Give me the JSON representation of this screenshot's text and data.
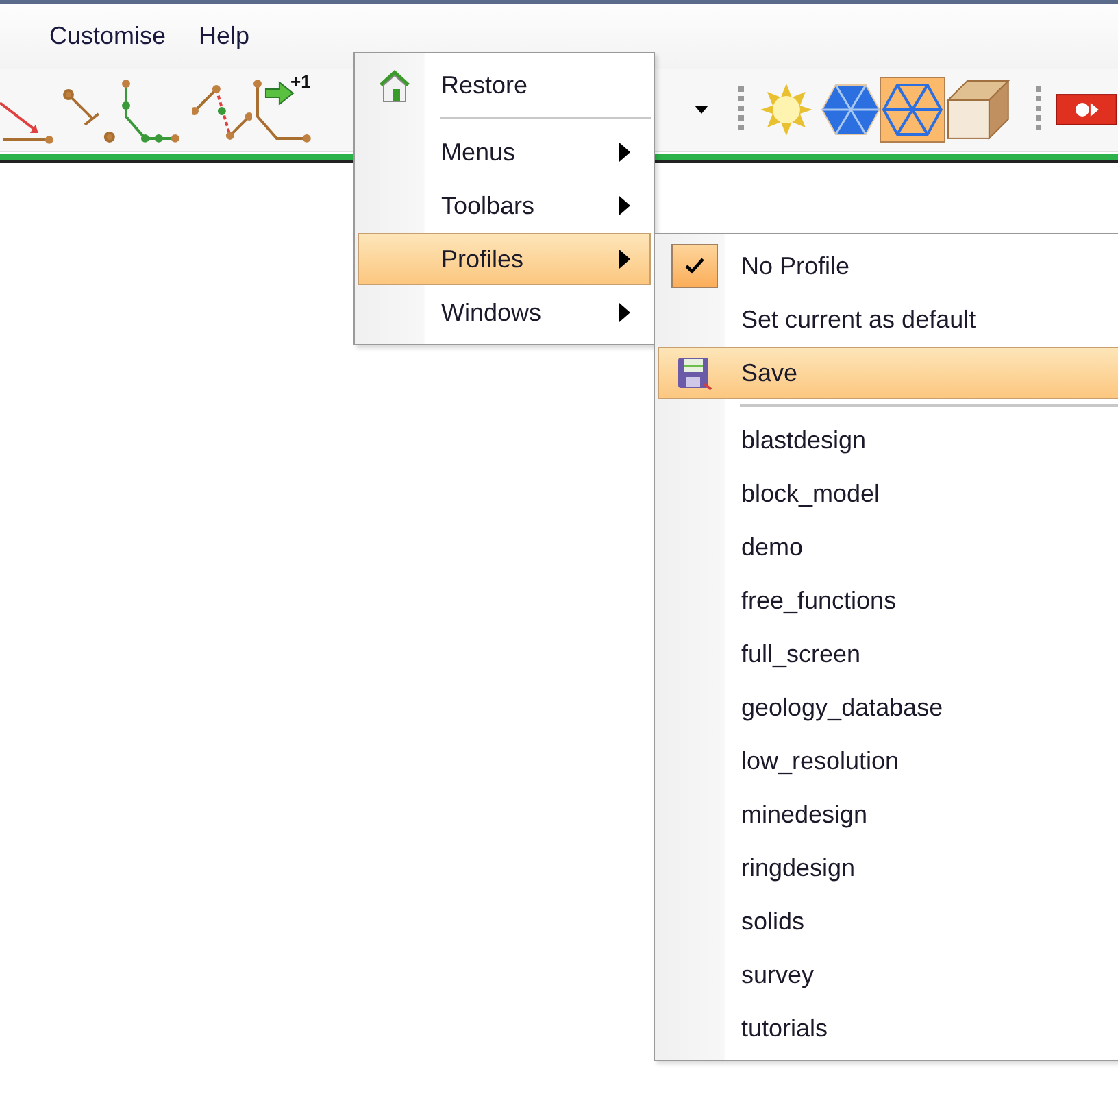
{
  "menubar": [
    {
      "label": "Customise"
    },
    {
      "label": "Help"
    }
  ],
  "toolbar": {
    "badge": "+1"
  },
  "menu": {
    "items": [
      {
        "kind": "icon",
        "label": "Restore",
        "selected": false
      },
      {
        "kind": "separator"
      },
      {
        "kind": "submenu",
        "label": "Menus",
        "selected": false
      },
      {
        "kind": "submenu",
        "label": "Toolbars",
        "selected": false
      },
      {
        "kind": "submenu",
        "label": "Profiles",
        "selected": true
      },
      {
        "kind": "submenu",
        "label": "Windows",
        "selected": false
      }
    ]
  },
  "submenu": {
    "items": [
      {
        "kind": "check",
        "label": "No Profile",
        "checked": true,
        "selected": false
      },
      {
        "kind": "plain",
        "label": "Set current as default",
        "selected": false
      },
      {
        "kind": "icon",
        "label": "Save",
        "selected": true
      },
      {
        "kind": "separator"
      },
      {
        "kind": "plain",
        "label": "blastdesign",
        "selected": false
      },
      {
        "kind": "plain",
        "label": "block_model",
        "selected": false
      },
      {
        "kind": "plain",
        "label": "demo",
        "selected": false
      },
      {
        "kind": "plain",
        "label": "free_functions",
        "selected": false
      },
      {
        "kind": "plain",
        "label": "full_screen",
        "selected": false
      },
      {
        "kind": "plain",
        "label": "geology_database",
        "selected": false
      },
      {
        "kind": "plain",
        "label": "low_resolution",
        "selected": false
      },
      {
        "kind": "plain",
        "label": "minedesign",
        "selected": false
      },
      {
        "kind": "plain",
        "label": "ringdesign",
        "selected": false
      },
      {
        "kind": "plain",
        "label": "solids",
        "selected": false
      },
      {
        "kind": "plain",
        "label": "survey",
        "selected": false
      },
      {
        "kind": "plain",
        "label": "tutorials",
        "selected": false
      }
    ]
  }
}
